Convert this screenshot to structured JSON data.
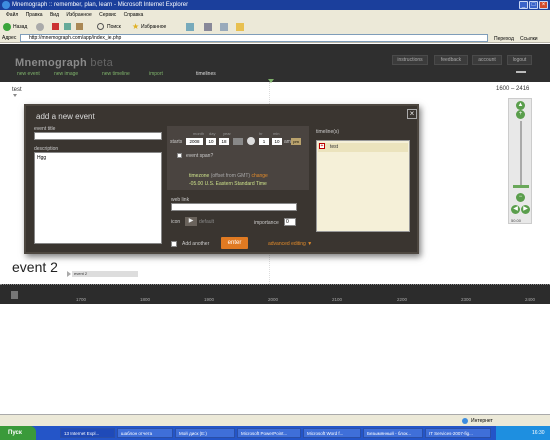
{
  "window": {
    "title": "Mnemograph :: remember, plan, learn - Microsoft Internet Explorer"
  },
  "menu": [
    "Файл",
    "Правка",
    "Вид",
    "Избранное",
    "Сервис",
    "Справка"
  ],
  "toolbar": {
    "back": "Назад",
    "search": "Поиск",
    "favorites": "Избранное"
  },
  "address": {
    "label": "Адрес",
    "url": "http://mnemograph.com/app/index_ie.php",
    "go": "Переход",
    "links": "Ссылки"
  },
  "app": {
    "logo_main": "Mnemograph",
    "logo_beta": "beta",
    "header_buttons": [
      "instructions",
      "feedback",
      "account",
      "logout"
    ],
    "nav": {
      "new_event": "new event",
      "new_image": "new image",
      "new_timeline": "new timeline",
      "import": "import",
      "timelines": "timelines"
    }
  },
  "timeline": {
    "label": "test",
    "range": "1600 – 2416"
  },
  "dialog": {
    "title": "add a new event",
    "event_title_label": "event title",
    "description_label": "description",
    "description_value": "Hgg",
    "date_headers": [
      "month",
      "day",
      "year",
      "hr",
      "min"
    ],
    "starts_label": "starts",
    "date_values": {
      "month": "2008",
      "day": "10",
      "year": "18",
      "hr": "1",
      "min": "10"
    },
    "ampm": "pm",
    "event_span_label": "event span?",
    "timezone_label": "timezone",
    "timezone_hint": "(offset from GMT)",
    "timezone_change": "change",
    "timezone_value": "-05.00 U.S. Eastern Standard Time",
    "web_link_label": "web link",
    "icon_label": "icon",
    "icon_default": "default",
    "importance_label": "importance",
    "importance_value": "0",
    "add_another_label": "Add another",
    "enter_label": "enter",
    "advanced_label": "advanced editing ▼",
    "timelines_label": "timeline(s)",
    "timelines_items": [
      "test"
    ]
  },
  "event": {
    "title": "event 2",
    "bar_label": "event 2"
  },
  "scale": {
    "years": [
      "1700",
      "1800",
      "1900",
      "2000",
      "2100",
      "2200",
      "2300",
      "2400"
    ]
  },
  "zoom": {
    "value": "50.00"
  },
  "status": {
    "internet": "Интернет"
  },
  "taskbar": {
    "start": "Пуск",
    "tasks": [
      "13 Internet Expl...",
      "шаблон отчета",
      "Мой диск (E:)",
      "Microsoft PowerPoint...",
      "Microsoft Word f...",
      "Безымянный - блок...",
      "IT Services-2007-fig..."
    ],
    "clock": "16:30"
  }
}
